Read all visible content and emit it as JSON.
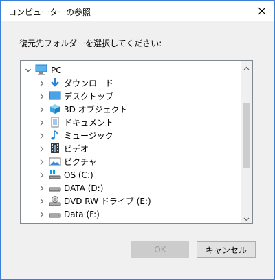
{
  "dialog": {
    "title": "コンピューターの参照",
    "instruction": "復元先フォルダーを選択してください:",
    "ok_label": "OK",
    "cancel_label": "キャンセル",
    "ok_enabled": false
  },
  "tree": {
    "root": {
      "label": "PC",
      "icon": "pc-icon",
      "expanded": true
    },
    "items": [
      {
        "label": "ダウンロード",
        "icon": "download-icon"
      },
      {
        "label": "デスクトップ",
        "icon": "desktop-icon"
      },
      {
        "label": "3D オブジェクト",
        "icon": "3d-objects-icon"
      },
      {
        "label": "ドキュメント",
        "icon": "documents-icon"
      },
      {
        "label": "ミュージック",
        "icon": "music-icon"
      },
      {
        "label": "ビデオ",
        "icon": "video-icon"
      },
      {
        "label": "ピクチャ",
        "icon": "pictures-icon"
      },
      {
        "label": "OS (C:)",
        "icon": "os-drive-icon"
      },
      {
        "label": "DATA (D:)",
        "icon": "drive-icon"
      },
      {
        "label": "DVD RW ドライブ (E:)",
        "icon": "dvd-drive-icon"
      },
      {
        "label": "Data (F:)",
        "icon": "drive-icon"
      }
    ]
  }
}
